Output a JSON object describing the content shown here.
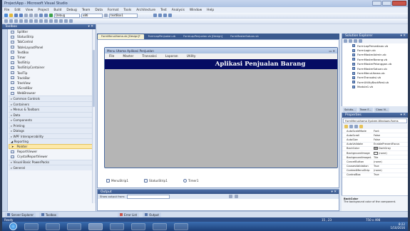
{
  "window": {
    "title": "ProjectApp - Microsoft Visual Studio"
  },
  "menubar": [
    "File",
    "Edit",
    "View",
    "Project",
    "Build",
    "Debug",
    "Team",
    "Data",
    "Format",
    "Tools",
    "Architecture",
    "Test",
    "Analysis",
    "Window",
    "Help"
  ],
  "toolbar": {
    "config": "Debug",
    "platform": "x86",
    "find": "textBox1"
  },
  "toolbox": {
    "title": "Toolbox",
    "items": [
      "Splitter",
      "StatusStrip",
      "TabControl",
      "TableLayoutPanel",
      "TextBox",
      "Timer",
      "ToolStrip",
      "ToolStripContainer",
      "ToolTip",
      "TrackBar",
      "TreeView",
      "VScrollBar",
      "WebBrowser"
    ],
    "categories": [
      "Common Controls",
      "Containers",
      "Menus & Toolbars",
      "Data",
      "Components",
      "Printing",
      "Dialogs",
      "WPF Interoperability",
      "Reporting"
    ],
    "reporting_items": [
      "Pointer",
      "ReportViewer",
      "CrystalReportViewer"
    ],
    "categories_tail": [
      "Visual Basic PowerPacks",
      "General"
    ]
  },
  "tabs": [
    "FormMenuUtama.vb [Design]*",
    "FormLapPenjualan.vb",
    "FormLapPenjualan.vb [Design]",
    "FormMasterSatuan.vb"
  ],
  "form": {
    "title": "Menu Utama Aplikasi Penjualan",
    "menu": [
      "File",
      "Master",
      "Transaksi",
      "Laporan",
      "Utility"
    ],
    "header": "Aplikasi Penjualan Barang"
  },
  "tray": [
    "MenuStrip1",
    "StatusStrip1",
    "Timer1"
  ],
  "output": {
    "title": "Output",
    "show_label": "Show output from:"
  },
  "solution": {
    "title": "Solution Explorer",
    "items": [
      "FormLapPersediaan.vb",
      "FormLogin.vb",
      "FormMasterAdmin.vb",
      "FormMasterBarang.vb",
      "FormMasterPelanggan.vb",
      "FormMasterSatuan.vb",
      "FormMenuUtama.vb",
      "FormTransaksi.vb",
      "FormUtilityBackRest.vb",
      "Module1.vb"
    ],
    "tabs": [
      "Solutio...",
      "Team E...",
      "Class Vi..."
    ]
  },
  "properties": {
    "title": "Properties",
    "object": "FormMenuUtama  System.Windows.Forms",
    "rows": [
      {
        "k": "AutoScaleMode",
        "v": "Font"
      },
      {
        "k": "AutoScroll",
        "v": "False"
      },
      {
        "k": "AutoSize",
        "v": "False"
      },
      {
        "k": "AutoValidate",
        "v": "EnablePreventFocus"
      },
      {
        "k": "BackColor",
        "v": "DarkGray"
      },
      {
        "k": "BackgroundImage",
        "v": "(none)"
      },
      {
        "k": "BackgroundImageL",
        "v": "Tile"
      },
      {
        "k": "CancelButton",
        "v": "(none)"
      },
      {
        "k": "CausesValidation",
        "v": "True"
      },
      {
        "k": "ContextMenuStrip",
        "v": "(none)"
      },
      {
        "k": "ControlBox",
        "v": "True"
      }
    ],
    "desc_title": "BackColor",
    "desc": "The background color of the component."
  },
  "bottom_tabs": [
    "Server Explorer",
    "Toolbox",
    "Error List",
    "Output"
  ],
  "status": {
    "left": "Ready",
    "pos": "15 , 23",
    "size": "750 x 498"
  },
  "clock": {
    "time": "8:22",
    "date": "1/10/2016"
  }
}
